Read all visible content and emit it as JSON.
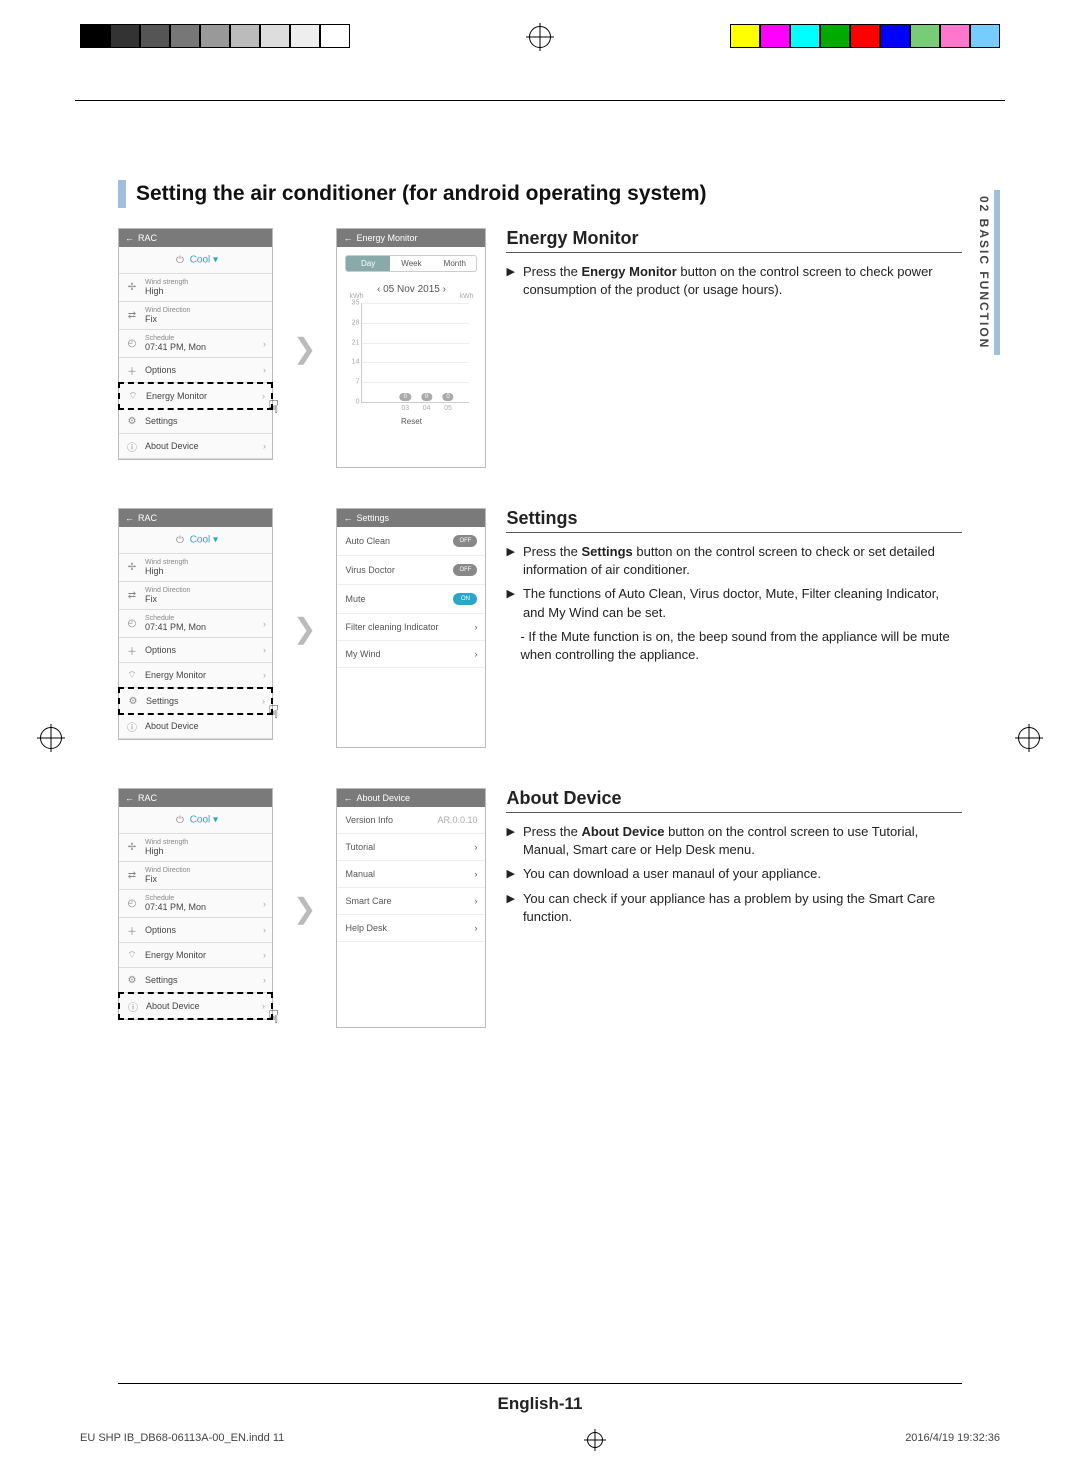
{
  "page": {
    "section_title": "Setting the air conditioner (for android operating system)",
    "footer": "English-11",
    "print_file": "EU SHP IB_DB68-06113A-00_EN.indd   11",
    "print_date": "2016/4/19   19:32:36",
    "side_tab": "02  BASIC FUNCTION"
  },
  "rac": {
    "header": "RAC",
    "mode": "Cool",
    "wind_strength_label": "Wind strength",
    "wind_strength_value": "High",
    "wind_direction_label": "Wind Direction",
    "wind_direction_value": "Fix",
    "schedule_label": "Schedule",
    "schedule_value": "07:41 PM, Mon",
    "options": "Options",
    "energy_monitor": "Energy Monitor",
    "settings": "Settings",
    "about_device": "About Device"
  },
  "energy_monitor": {
    "title": "Energy Monitor",
    "header": "Energy Monitor",
    "tab_day": "Day",
    "tab_week": "Week",
    "tab_month": "Month",
    "date": "05 Nov 2015",
    "kwh_label": "kWh",
    "kwh_unit": "kWh",
    "reset": "Reset",
    "desc_prefix": "Press the ",
    "desc_bold": "Energy Monitor",
    "desc_suffix": " button on the control screen to check power consumption of the product (or usage hours)."
  },
  "chart_data": {
    "type": "bar",
    "categories": [
      "03",
      "04",
      "05"
    ],
    "values": [
      0.0,
      0.0,
      0.0
    ],
    "y_ticks": [
      0,
      7,
      14,
      21,
      28,
      35
    ],
    "xlabel": "",
    "ylabel": "kWh",
    "ylim": [
      0,
      35
    ]
  },
  "settings": {
    "title": "Settings",
    "header": "Settings",
    "auto_clean": "Auto Clean",
    "virus_doctor": "Virus Doctor",
    "mute": "Mute",
    "filter": "Filter cleaning Indicator",
    "my_wind": "My Wind",
    "off": "OFF",
    "on": "ON",
    "b1_prefix": "Press the ",
    "b1_bold": "Settings",
    "b1_suffix": " button on the control screen to check or set detailed information of air conditioner.",
    "b2": "The functions of Auto Clean, Virus doctor, Mute, Filter cleaning Indicator, and My Wind can be set.",
    "b2_sub": "If the Mute function is on, the beep sound from the appliance will be mute when controlling the appliance."
  },
  "about": {
    "title": "About Device",
    "header": "About Device",
    "version_label": "Version Info",
    "version_value": "AR.0.0.10",
    "tutorial": "Tutorial",
    "manual": "Manual",
    "smart_care": "Smart Care",
    "help_desk": "Help Desk",
    "b1_prefix": "Press the ",
    "b1_bold": "About Device",
    "b1_suffix": " button on the control screen to use Tutorial, Manual, Smart care or Help Desk menu.",
    "b2": "You can download a user manaul of your appliance.",
    "b3": "You can check if your appliance has a problem by using the Smart Care function."
  }
}
